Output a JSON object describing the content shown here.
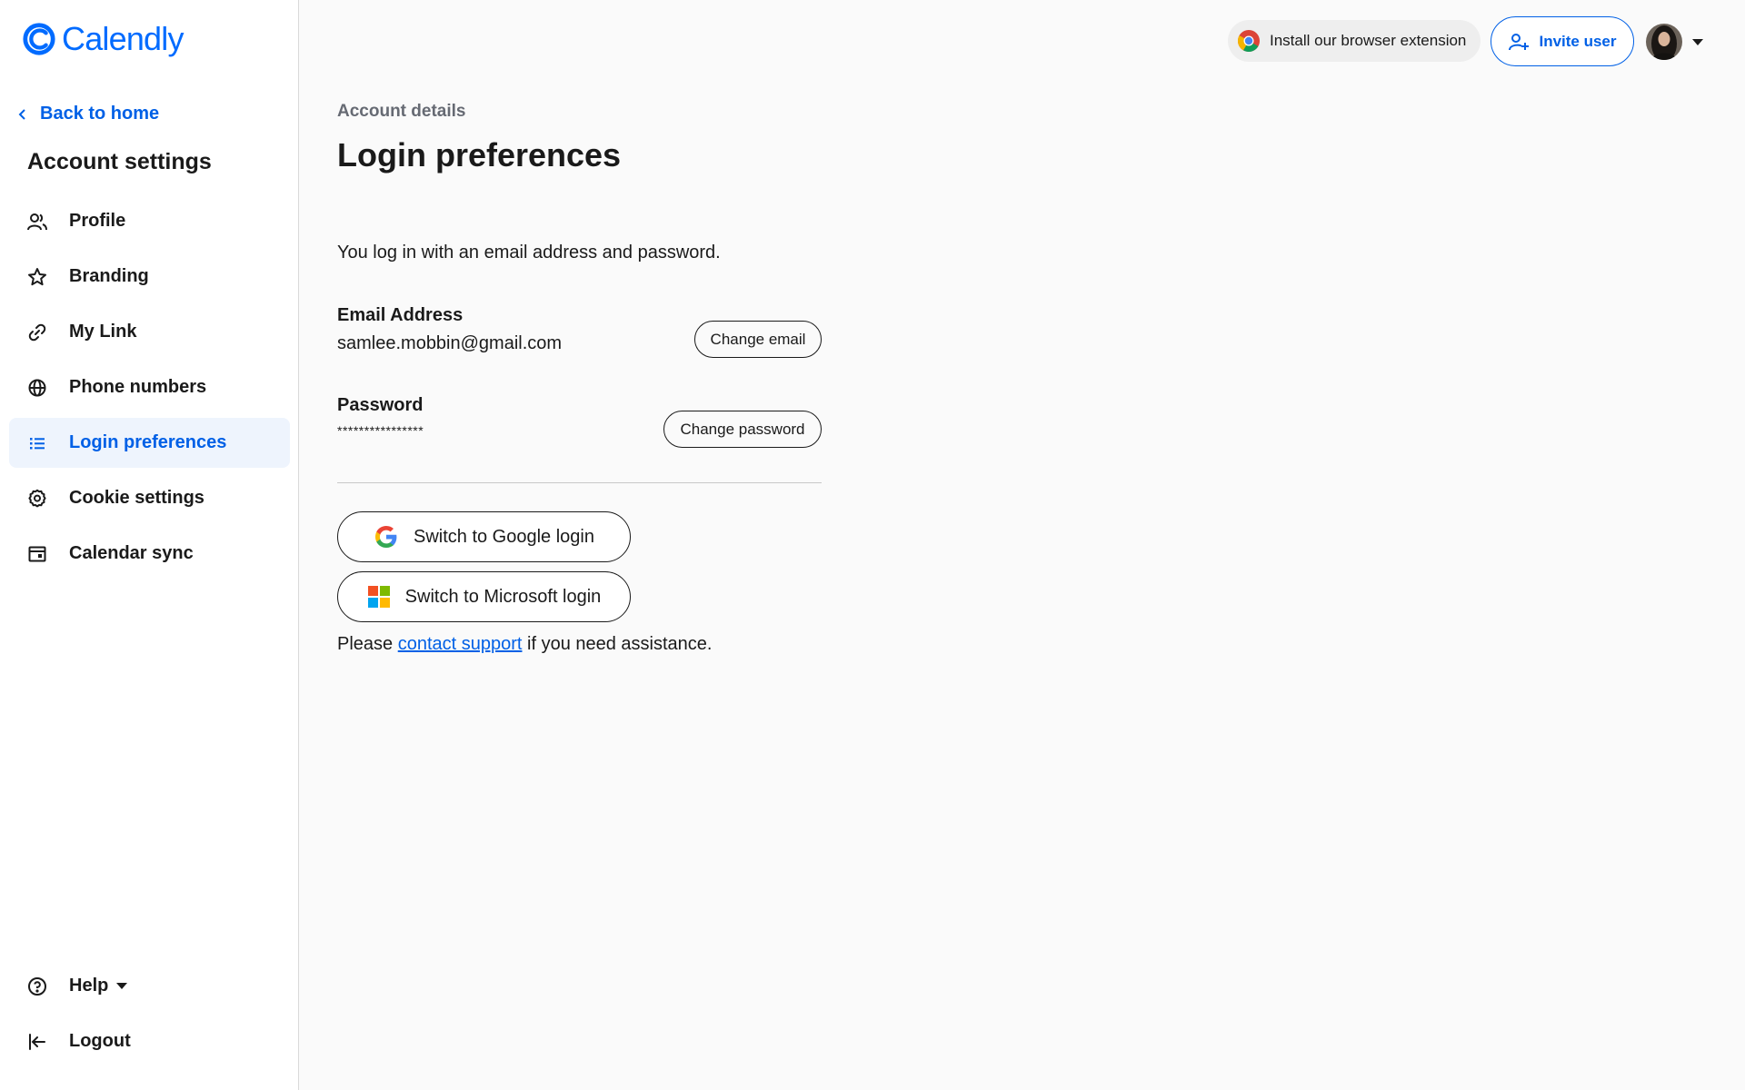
{
  "brand": {
    "name": "Calendly",
    "color": "#006bff"
  },
  "sidebar": {
    "back_label": "Back to home",
    "section_title": "Account settings",
    "items": [
      {
        "label": "Profile",
        "icon": "users-icon"
      },
      {
        "label": "Branding",
        "icon": "star-icon"
      },
      {
        "label": "My Link",
        "icon": "link-icon"
      },
      {
        "label": "Phone numbers",
        "icon": "globe-icon"
      },
      {
        "label": "Login preferences",
        "icon": "list-icon",
        "active": true
      },
      {
        "label": "Cookie settings",
        "icon": "gear-icon"
      },
      {
        "label": "Calendar sync",
        "icon": "calendar-icon"
      }
    ],
    "bottom": [
      {
        "label": "Help",
        "icon": "help-circle-icon"
      },
      {
        "label": "Logout",
        "icon": "logout-icon"
      }
    ]
  },
  "topbar": {
    "extension_label": "Install our browser extension",
    "invite_label": "Invite user"
  },
  "main": {
    "breadcrumb": "Account details",
    "title": "Login preferences",
    "intro": "You log in with an email address and password.",
    "email": {
      "label": "Email Address",
      "value": "samlee.mobbin@gmail.com",
      "button": "Change email"
    },
    "password": {
      "label": "Password",
      "value": "****************",
      "button": "Change password"
    },
    "google_button": "Switch to Google login",
    "microsoft_button": "Switch to Microsoft login",
    "support": {
      "before": "Please ",
      "link": "contact support",
      "after": " if you need assistance."
    }
  },
  "colors": {
    "accent": "#0060e6",
    "active_bg": "#eef4fd"
  }
}
